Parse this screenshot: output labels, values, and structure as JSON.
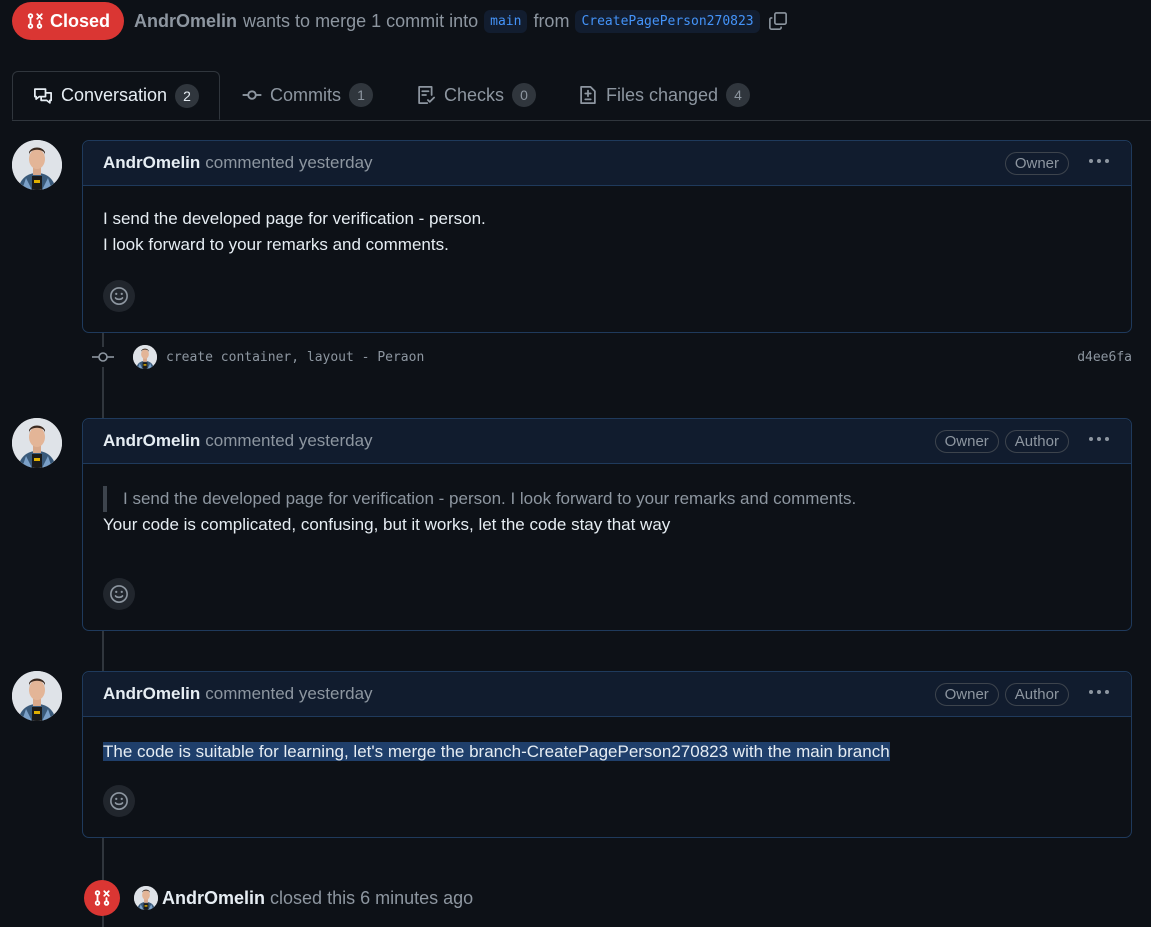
{
  "header": {
    "state": "Closed",
    "author": "AndrOmelin",
    "text_before_base": "wants to merge 1 commit into",
    "base_branch": "main",
    "text_from": "from",
    "head_branch": "CreatePagePerson270823"
  },
  "tabs": [
    {
      "label": "Conversation",
      "count": "2",
      "icon": "comment-discussion-icon"
    },
    {
      "label": "Commits",
      "count": "1",
      "icon": "git-commit-icon"
    },
    {
      "label": "Checks",
      "count": "0",
      "icon": "checklist-icon"
    },
    {
      "label": "Files changed",
      "count": "4",
      "icon": "file-diff-icon"
    }
  ],
  "comments": [
    {
      "author": "AndrOmelin",
      "meta": "commented yesterday",
      "labels": [
        "Owner"
      ],
      "lines": [
        "I send the developed page for verification - person.",
        "I look forward to your remarks and comments."
      ]
    },
    {
      "author": "AndrOmelin",
      "meta": "commented yesterday",
      "labels": [
        "Owner",
        "Author"
      ],
      "quote": "I send the developed page for verification - person. I look forward to your remarks and comments.",
      "text": "Your code is complicated, confusing, but it works, let the code stay that way"
    },
    {
      "author": "AndrOmelin",
      "meta": "commented yesterday",
      "labels": [
        "Owner",
        "Author"
      ],
      "text": "The code is suitable for learning, let's merge the branch-CreatePagePerson270823 with the main branch"
    }
  ],
  "commit": {
    "message": "create container, layout - Peraon",
    "sha": "d4ee6fa"
  },
  "closed_event": {
    "author": "AndrOmelin",
    "text": "closed this 6 minutes ago"
  },
  "colors": {
    "background": "#0d1117",
    "closed": "#da3633",
    "accent_link": "#4493f8",
    "comment_border": "#1f3a5c"
  }
}
